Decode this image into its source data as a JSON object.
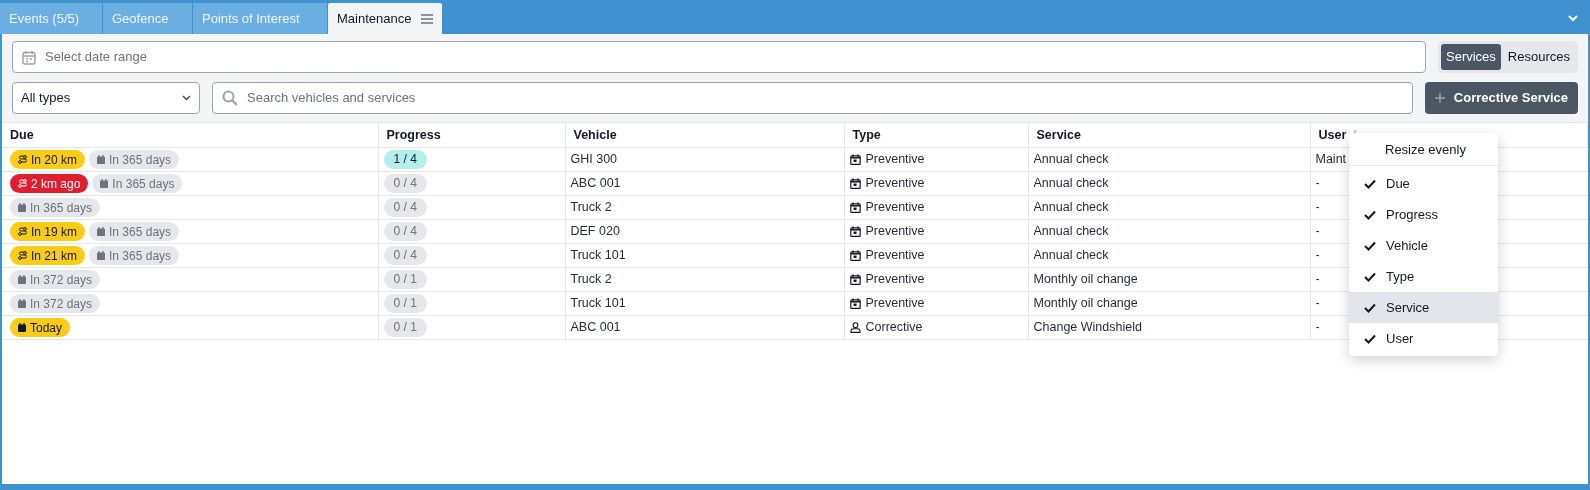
{
  "tabs": [
    {
      "label": "Events (5/5)",
      "selected": false,
      "menu": false
    },
    {
      "label": "Geofence",
      "selected": false,
      "menu": false
    },
    {
      "label": "Points of Interest",
      "selected": false,
      "menu": false
    },
    {
      "label": "Maintenance",
      "selected": true,
      "menu": true
    }
  ],
  "date_range": {
    "placeholder": "Select date range"
  },
  "view_toggle": [
    {
      "label": "Services",
      "selected": true
    },
    {
      "label": "Resources",
      "selected": false
    }
  ],
  "type_filter": {
    "value": "All types"
  },
  "search": {
    "placeholder": "Search vehicles and services"
  },
  "add_button": {
    "label": "Corrective Service"
  },
  "table": {
    "columns": [
      {
        "label": "Due",
        "sorted": false
      },
      {
        "label": "Progress",
        "sorted": false
      },
      {
        "label": "Vehicle",
        "sorted": false
      },
      {
        "label": "Type",
        "sorted": false
      },
      {
        "label": "Service",
        "sorted": false
      },
      {
        "label": "User",
        "sorted": true
      }
    ],
    "rows": [
      {
        "due": [
          {
            "kind": "distance",
            "color": "#facc15",
            "text": "In 20 km"
          },
          {
            "kind": "date",
            "color": "#e5e7eb",
            "text": "In 365 days"
          }
        ],
        "progress": {
          "text": "1 / 4",
          "started": true
        },
        "vehicle": "GHI 300",
        "type": {
          "kind": "preventive",
          "text": "Preventive"
        },
        "service": "Annual check",
        "user": "Maint"
      },
      {
        "due": [
          {
            "kind": "distance",
            "color": "#e11d2e",
            "text": "2 km ago"
          },
          {
            "kind": "date",
            "color": "#e5e7eb",
            "text": "In 365 days"
          }
        ],
        "progress": {
          "text": "0 / 4",
          "started": false
        },
        "vehicle": "ABC 001",
        "type": {
          "kind": "preventive",
          "text": "Preventive"
        },
        "service": "Annual check",
        "user": "-"
      },
      {
        "due": [
          {
            "kind": "date",
            "color": "#e5e7eb",
            "text": "In 365 days"
          }
        ],
        "progress": {
          "text": "0 / 4",
          "started": false
        },
        "vehicle": "Truck 2",
        "type": {
          "kind": "preventive",
          "text": "Preventive"
        },
        "service": "Annual check",
        "user": "-"
      },
      {
        "due": [
          {
            "kind": "distance",
            "color": "#facc15",
            "text": "In 19 km"
          },
          {
            "kind": "date",
            "color": "#e5e7eb",
            "text": "In 365 days"
          }
        ],
        "progress": {
          "text": "0 / 4",
          "started": false
        },
        "vehicle": "DEF 020",
        "type": {
          "kind": "preventive",
          "text": "Preventive"
        },
        "service": "Annual check",
        "user": "-"
      },
      {
        "due": [
          {
            "kind": "distance",
            "color": "#facc15",
            "text": "In 21 km"
          },
          {
            "kind": "date",
            "color": "#e5e7eb",
            "text": "In 365 days"
          }
        ],
        "progress": {
          "text": "0 / 4",
          "started": false
        },
        "vehicle": "Truck 101",
        "type": {
          "kind": "preventive",
          "text": "Preventive"
        },
        "service": "Annual check",
        "user": "-"
      },
      {
        "due": [
          {
            "kind": "date",
            "color": "#e5e7eb",
            "text": "In 372 days"
          }
        ],
        "progress": {
          "text": "0 / 1",
          "started": false
        },
        "vehicle": "Truck 2",
        "type": {
          "kind": "preventive",
          "text": "Preventive"
        },
        "service": "Monthly oil change",
        "user": "-"
      },
      {
        "due": [
          {
            "kind": "date",
            "color": "#e5e7eb",
            "text": "In 372 days"
          }
        ],
        "progress": {
          "text": "0 / 1",
          "started": false
        },
        "vehicle": "Truck 101",
        "type": {
          "kind": "preventive",
          "text": "Preventive"
        },
        "service": "Monthly oil change",
        "user": "-"
      },
      {
        "due": [
          {
            "kind": "date",
            "color": "#facc15",
            "text": "Today"
          }
        ],
        "progress": {
          "text": "0 / 1",
          "started": false
        },
        "vehicle": "ABC 001",
        "type": {
          "kind": "corrective",
          "text": "Corrective"
        },
        "service": "Change Windshield",
        "user": "-"
      }
    ]
  },
  "column_menu": {
    "action": "Resize evenly",
    "items": [
      {
        "label": "Due",
        "checked": true,
        "selected": false
      },
      {
        "label": "Progress",
        "checked": true,
        "selected": false
      },
      {
        "label": "Vehicle",
        "checked": true,
        "selected": false
      },
      {
        "label": "Type",
        "checked": true,
        "selected": false
      },
      {
        "label": "Service",
        "checked": true,
        "selected": true
      },
      {
        "label": "User",
        "checked": true,
        "selected": false
      }
    ]
  }
}
